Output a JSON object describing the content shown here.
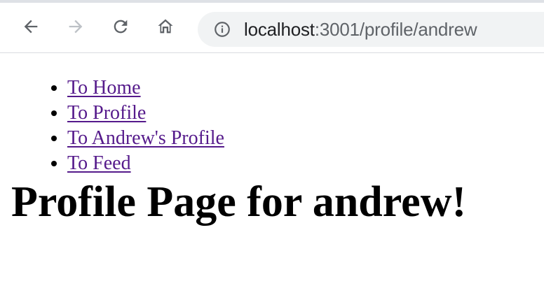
{
  "browser": {
    "url_host": "localhost",
    "url_path": ":3001/profile/andrew",
    "icons": {
      "back": "back-arrow-icon",
      "forward": "forward-arrow-icon",
      "reload": "reload-icon",
      "home": "home-icon",
      "site_info": "info-icon"
    }
  },
  "nav": {
    "links": [
      {
        "label": "To Home"
      },
      {
        "label": "To Profile"
      },
      {
        "label": "To Andrew's Profile"
      },
      {
        "label": "To Feed"
      }
    ]
  },
  "page": {
    "title": "Profile Page for andrew!"
  },
  "colors": {
    "link_visited": "#551a8b",
    "omnibox_bg": "#f1f3f4",
    "icon": "#5f6368",
    "icon_disabled": "#bdc1c6"
  }
}
